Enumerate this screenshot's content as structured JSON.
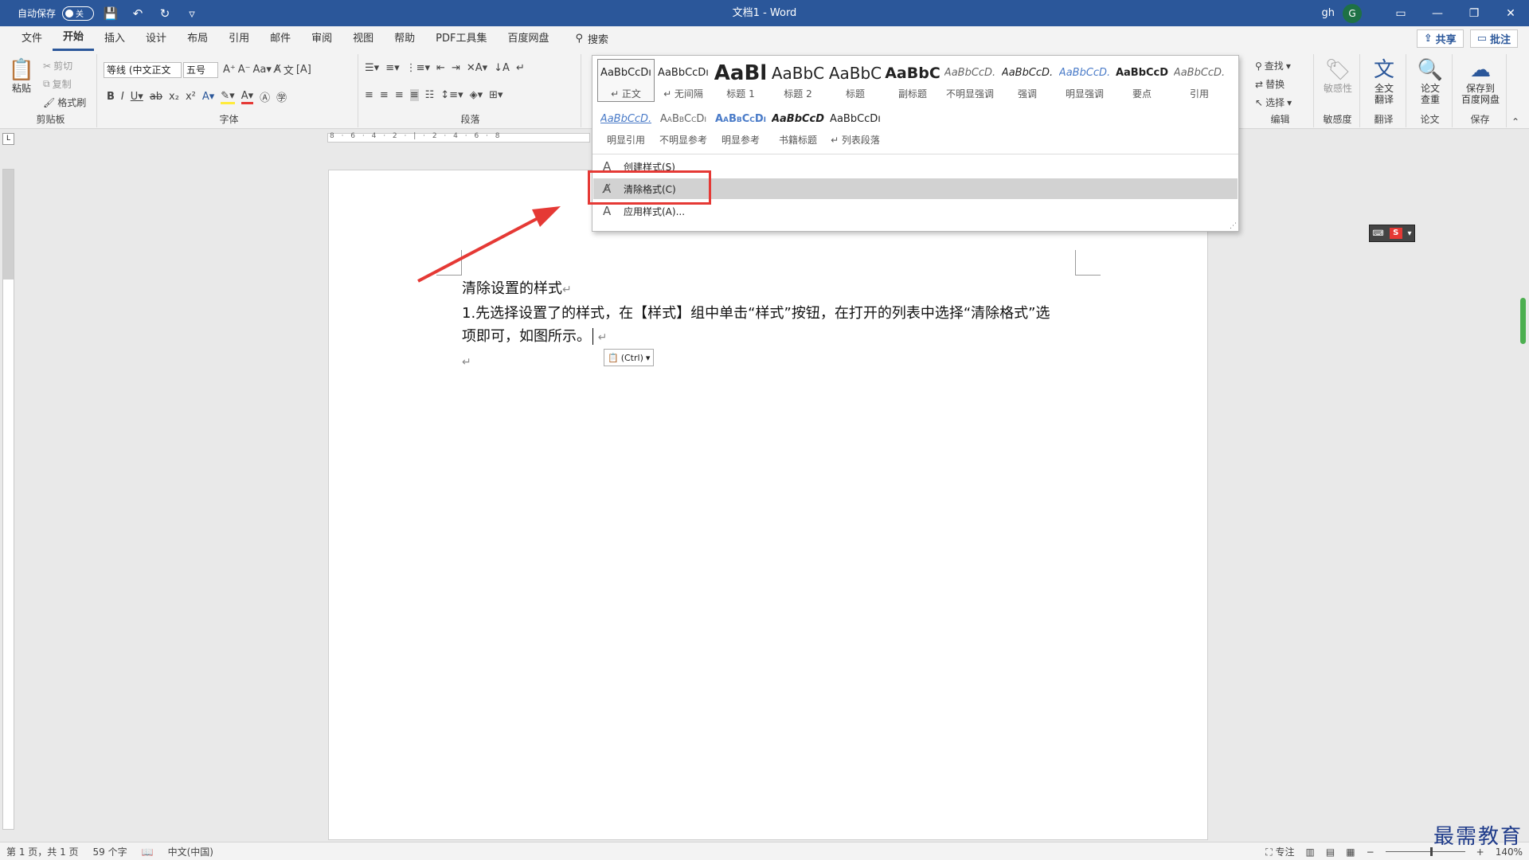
{
  "titlebar": {
    "autosave_label": "自动保存",
    "autosave_state": "关",
    "document_title": "文档1  -  Word",
    "user_initials": "gh",
    "avatar_letter": "G"
  },
  "tabs": {
    "items": [
      "文件",
      "开始",
      "插入",
      "设计",
      "布局",
      "引用",
      "邮件",
      "审阅",
      "视图",
      "帮助",
      "PDF工具集",
      "百度网盘"
    ],
    "search_label": "搜索",
    "share_label": "共享",
    "comments_label": "批注"
  },
  "ribbon": {
    "clipboard": {
      "paste": "粘贴",
      "cut": "剪切",
      "copy": "复制",
      "format_painter": "格式刷",
      "label": "剪贴板"
    },
    "font": {
      "font_name": "等线 (中文正文",
      "font_size": "五号",
      "label": "字体"
    },
    "paragraph": {
      "label": "段落"
    },
    "editing": {
      "find": "查找",
      "replace": "替换",
      "select": "选择",
      "label": "编辑"
    },
    "sensitivity": {
      "btn": "敏感性",
      "label": "敏感度"
    },
    "translate": {
      "btn_line1": "全文",
      "btn_line2": "翻译",
      "label": "翻译"
    },
    "paper": {
      "btn_line1": "论文",
      "btn_line2": "查重",
      "label": "论文"
    },
    "save": {
      "btn_line1": "保存到",
      "btn_line2": "百度网盘",
      "label": "保存"
    }
  },
  "styles_gallery": {
    "row1": [
      {
        "preview": "AaBbCcDı",
        "name": "↵ 正文"
      },
      {
        "preview": "AaBbCcDı",
        "name": "↵ 无间隔"
      },
      {
        "preview": "AaBl",
        "name": "标题 1"
      },
      {
        "preview": "AaBbC",
        "name": "标题 2"
      },
      {
        "preview": "AaBbC",
        "name": "标题"
      },
      {
        "preview": "AaBbC",
        "name": "副标题"
      },
      {
        "preview": "AaBbCcD.",
        "name": "不明显强调"
      },
      {
        "preview": "AaBbCcD.",
        "name": "强调"
      },
      {
        "preview": "AaBbCcD.",
        "name": "明显强调"
      },
      {
        "preview": "AaBbCcD",
        "name": "要点"
      },
      {
        "preview": "AaBbCcD.",
        "name": "引用"
      }
    ],
    "row2": [
      {
        "preview": "AaBbCcD.",
        "name": "明显引用"
      },
      {
        "preview": "AaBbCcDı",
        "name": "不明显参考"
      },
      {
        "preview": "AaBbCcDı",
        "name": "明显参考"
      },
      {
        "preview": "AaBbCcD",
        "name": "书籍标题"
      },
      {
        "preview": "AaBbCcDı",
        "name": "↵ 列表段落"
      }
    ],
    "commands": {
      "create_style": "创建样式(S)",
      "clear_formatting": "清除格式(C)",
      "apply_styles": "应用样式(A)..."
    }
  },
  "ruler": {
    "ticks": "8 · 6 · 4 · 2 · | · 2 · 4 · 6 · 8"
  },
  "document": {
    "line1": "清除设置的样式",
    "line2": "1.先选择设置了的样式，在【样式】组中单击“样式”按钮，在打开的列表中选择“清除格式”选",
    "line3": "项即可，如图所示。",
    "paste_options": "(Ctrl)"
  },
  "statusbar": {
    "page": "第 1 页，共 1 页",
    "words": "59 个字",
    "language": "中文(中国)",
    "focus": "专注",
    "zoom": "140%"
  },
  "watermark": "最需教育",
  "colors": {
    "titlebar": "#2b579a",
    "highlight": "#e53935",
    "scroll_thumb": "#4caf50"
  }
}
